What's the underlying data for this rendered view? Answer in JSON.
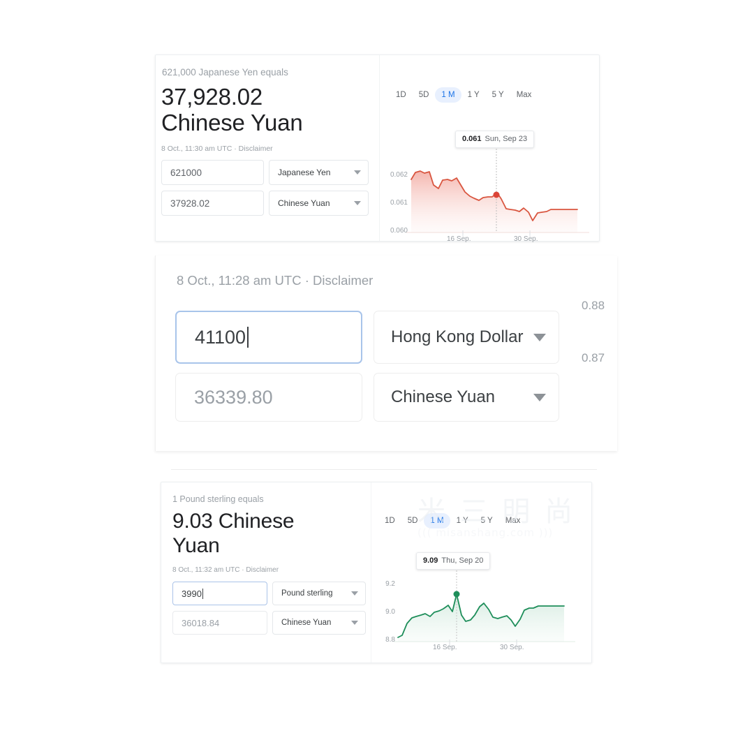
{
  "card1": {
    "equals_label": "621,000 Japanese Yen equals",
    "result_line1": "37,928.02",
    "result_line2": "Chinese Yuan",
    "timestamp": "8 Oct., 11:30 am UTC · Disclaimer",
    "from_amount": "621000",
    "from_currency": "Japanese Yen",
    "to_amount": "37928.02",
    "to_currency": "Chinese Yuan",
    "ranges": [
      "1D",
      "5D",
      "1 M",
      "1 Y",
      "5 Y",
      "Max"
    ],
    "active_range": "1 M",
    "tooltip_value": "0.061",
    "tooltip_date": "Sun, Sep 23"
  },
  "card2": {
    "timestamp": "8 Oct., 11:28 am UTC · Disclaimer",
    "from_amount": "41100",
    "from_currency": "Hong Kong Dollar",
    "to_amount": "36339.80",
    "to_currency": "Chinese Yuan",
    "axis_high": "0.88",
    "axis_low": "0.87"
  },
  "card3": {
    "equals_label": "1 Pound sterling equals",
    "result_line1": "9.03 Chinese",
    "result_line2": "Yuan",
    "timestamp": "8 Oct., 11:32 am UTC · Disclaimer",
    "from_amount": "3990",
    "from_currency": "Pound sterling",
    "to_amount": "36018.84",
    "to_currency": "Chinese Yuan",
    "ranges": [
      "1D",
      "5D",
      "1 M",
      "1 Y",
      "5 Y",
      "Max"
    ],
    "active_range": "1 M",
    "tooltip_value": "9.09",
    "tooltip_date": "Thu, Sep 20"
  },
  "watermark": {
    "line1": "米 三 明 尚",
    "line2": "((( misanshang.com )))"
  },
  "colors": {
    "accent_blue": "#1a73e8",
    "chart_red": "#db4437",
    "chart_red_line": "#d9553f",
    "chart_green": "#1e8e5a",
    "muted_text": "#9aa0a6",
    "primary_text": "#202124"
  },
  "chart_data": [
    {
      "type": "area",
      "id": "jpy-cny-1m",
      "title": "",
      "xlabel": "",
      "ylabel": "",
      "ylim": [
        0.0595,
        0.0622
      ],
      "yticks": [
        0.06,
        0.061,
        0.062
      ],
      "ytick_labels": [
        "0.060",
        "0.061",
        "0.062"
      ],
      "xticks": [
        "16 Sep.",
        "30 Sep."
      ],
      "grid": false,
      "legend": "none",
      "line_color": "#d9553f",
      "fill": "gradient-red",
      "highlight_point": {
        "x_label": "Sun, Sep 23",
        "y": 0.061
      },
      "x": [
        "Sep 7",
        "Sep 8",
        "Sep 9",
        "Sep 10",
        "Sep 11",
        "Sep 12",
        "Sep 13",
        "Sep 14",
        "Sep 15",
        "Sep 16",
        "Sep 17",
        "Sep 18",
        "Sep 19",
        "Sep 20",
        "Sep 21",
        "Sep 22",
        "Sep 23",
        "Sep 24",
        "Sep 25",
        "Sep 26",
        "Sep 27",
        "Sep 28",
        "Sep 29",
        "Sep 30",
        "Oct 1",
        "Oct 2",
        "Oct 3",
        "Oct 4",
        "Oct 5",
        "Oct 6",
        "Oct 7",
        "Oct 8"
      ],
      "values": [
        0.06155,
        0.06178,
        0.0618,
        0.06172,
        0.06178,
        0.0613,
        0.06118,
        0.06148,
        0.0615,
        0.06145,
        0.06155,
        0.0613,
        0.06105,
        0.0609,
        0.06082,
        0.06075,
        0.06085,
        0.06088,
        0.06088,
        0.06102,
        0.0608,
        0.06045,
        0.06042,
        0.0604,
        0.06035,
        0.06048,
        0.06032,
        0.06002,
        0.0603,
        0.06033,
        0.06035,
        0.06042
      ]
    },
    {
      "type": "area",
      "id": "gbp-cny-1m",
      "title": "",
      "xlabel": "",
      "ylabel": "",
      "ylim": [
        8.78,
        9.25
      ],
      "yticks": [
        8.8,
        9.0,
        9.2
      ],
      "ytick_labels": [
        "8.8",
        "9.0",
        "9.2"
      ],
      "xticks": [
        "16 Sep.",
        "30 Sep."
      ],
      "grid": false,
      "legend": "none",
      "line_color": "#1e8e5a",
      "fill": "gradient-green",
      "highlight_point": {
        "x_label": "Thu, Sep 20",
        "y": 9.09
      },
      "x": [
        "Sep 7",
        "Sep 8",
        "Sep 9",
        "Sep 10",
        "Sep 11",
        "Sep 12",
        "Sep 13",
        "Sep 14",
        "Sep 15",
        "Sep 16",
        "Sep 17",
        "Sep 18",
        "Sep 19",
        "Sep 20",
        "Sep 21",
        "Sep 22",
        "Sep 23",
        "Sep 24",
        "Sep 25",
        "Sep 26",
        "Sep 27",
        "Sep 28",
        "Sep 29",
        "Sep 30",
        "Oct 1",
        "Oct 2",
        "Oct 3",
        "Oct 4",
        "Oct 5",
        "Oct 6",
        "Oct 7",
        "Oct 8"
      ],
      "values": [
        8.82,
        8.83,
        8.9,
        8.94,
        8.95,
        8.96,
        8.97,
        8.95,
        8.98,
        8.99,
        9.0,
        9.02,
        8.99,
        9.09,
        8.97,
        8.93,
        8.94,
        8.97,
        9.02,
        9.04,
        9.0,
        8.96,
        8.95,
        8.96,
        8.97,
        8.94,
        8.9,
        8.94,
        8.99,
        9.0,
        9.0,
        9.01
      ]
    }
  ]
}
